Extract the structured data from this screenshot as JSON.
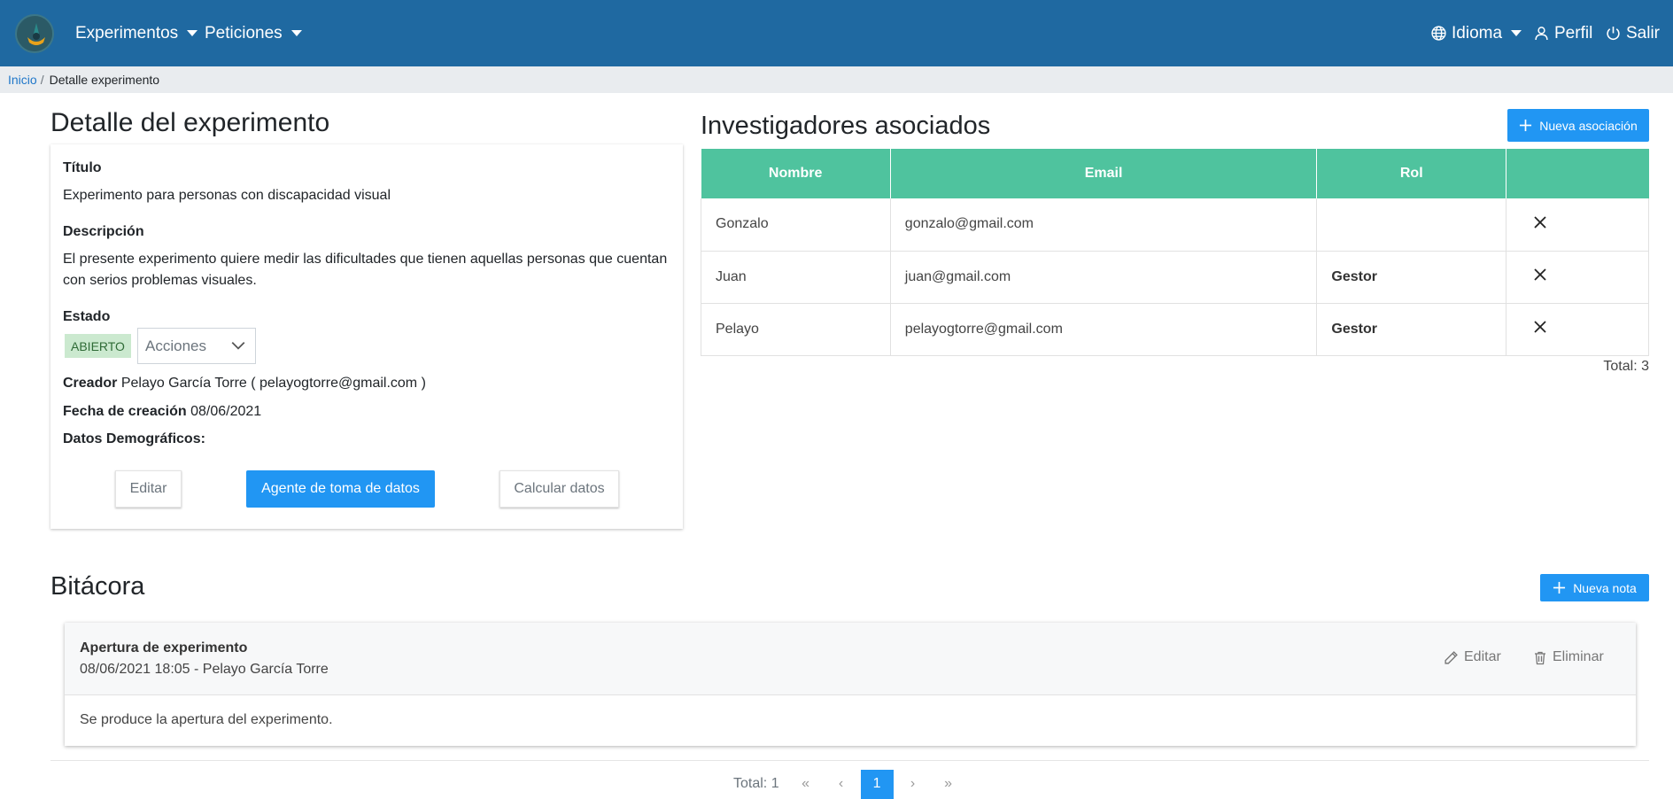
{
  "navbar": {
    "menu_experimentos": "Experimentos",
    "menu_peticiones": "Peticiones",
    "idioma": "Idioma",
    "perfil": "Perfil",
    "salir": "Salir"
  },
  "breadcrumb": {
    "home": "Inicio",
    "separator": "/",
    "current": "Detalle experimento"
  },
  "detail": {
    "heading": "Detalle del experimento",
    "titulo_label": "Título",
    "titulo_value": "Experimento para personas con discapacidad visual",
    "descripcion_label": "Descripción",
    "descripcion_value": "El presente experimento quiere medir las dificultades que tienen aquellas personas que cuentan con serios problemas visuales.",
    "estado_label": "Estado",
    "estado_badge": "ABIERTO",
    "acciones_placeholder": "Acciones",
    "creador_label": "Creador",
    "creador_value": "Pelayo García Torre ( pelayogtorre@gmail.com )",
    "fecha_label": "Fecha de creación",
    "fecha_value": "08/06/2021",
    "demograficos_label": "Datos Demográficos:",
    "btn_editar": "Editar",
    "btn_agente": "Agente de toma de datos",
    "btn_calcular": "Calcular datos"
  },
  "investigadores": {
    "heading": "Investigadores asociados",
    "btn_nueva": "Nueva asociación",
    "columns": [
      "Nombre",
      "Email",
      "Rol",
      ""
    ],
    "rows": [
      {
        "nombre": "Gonzalo",
        "email": "gonzalo@gmail.com",
        "rol": ""
      },
      {
        "nombre": "Juan",
        "email": "juan@gmail.com",
        "rol": "Gestor"
      },
      {
        "nombre": "Pelayo",
        "email": "pelayogtorre@gmail.com",
        "rol": "Gestor"
      }
    ],
    "total": "Total: 3"
  },
  "bitacora": {
    "heading": "Bitácora",
    "btn_nueva": "Nueva nota",
    "note": {
      "title": "Apertura de experimento",
      "meta": "08/06/2021 18:05 - Pelayo García Torre",
      "body": "Se produce la apertura del experimento.",
      "edit": "Editar",
      "delete": "Eliminar"
    },
    "pagination": {
      "total": "Total: 1",
      "first": "«",
      "prev": "‹",
      "current": "1",
      "next": "›",
      "last": "»"
    }
  },
  "colors": {
    "navbar": "#1f69a1",
    "primary": "#2196f3",
    "table_header": "#4fc39e",
    "badge_bg": "#cbe9cf"
  }
}
